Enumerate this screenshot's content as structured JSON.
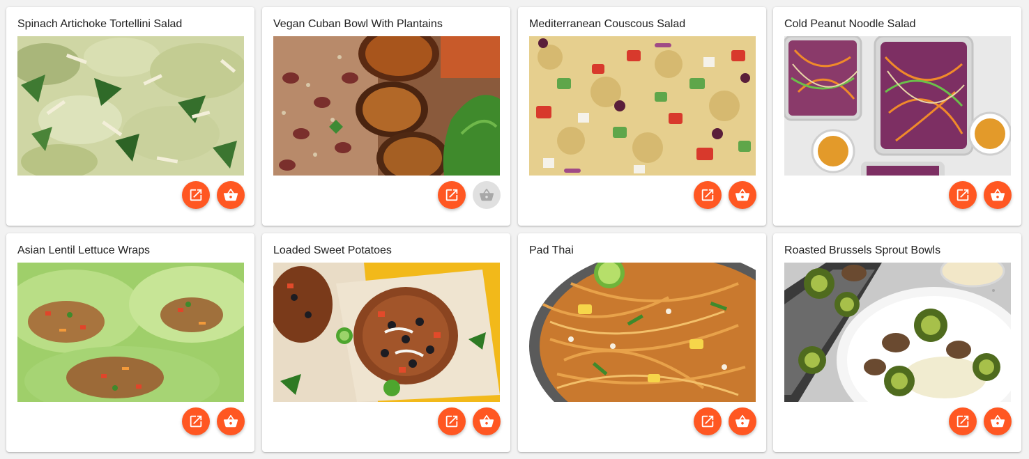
{
  "theme": {
    "accent": "#ff5722",
    "disabled": "#e0e0e0",
    "disabled_icon": "#a8a8a8"
  },
  "recipes": [
    {
      "title": "Spinach Artichoke Tortellini Salad",
      "image": "tortellini-salad-photo",
      "open_icon": "open-in-new-icon",
      "cart_icon": "shopping-basket-icon",
      "cart_enabled": true
    },
    {
      "title": "Vegan Cuban Bowl With Plantains",
      "image": "cuban-bowl-photo",
      "open_icon": "open-in-new-icon",
      "cart_icon": "shopping-basket-icon",
      "cart_enabled": false
    },
    {
      "title": "Mediterranean Couscous Salad",
      "image": "couscous-salad-photo",
      "open_icon": "open-in-new-icon",
      "cart_icon": "shopping-basket-icon",
      "cart_enabled": true
    },
    {
      "title": "Cold Peanut Noodle Salad",
      "image": "peanut-noodle-photo",
      "open_icon": "open-in-new-icon",
      "cart_icon": "shopping-basket-icon",
      "cart_enabled": true
    },
    {
      "title": "Asian Lentil Lettuce Wraps",
      "image": "lettuce-wraps-photo",
      "open_icon": "open-in-new-icon",
      "cart_icon": "shopping-basket-icon",
      "cart_enabled": true
    },
    {
      "title": "Loaded Sweet Potatoes",
      "image": "sweet-potatoes-photo",
      "open_icon": "open-in-new-icon",
      "cart_icon": "shopping-basket-icon",
      "cart_enabled": true
    },
    {
      "title": "Pad Thai",
      "image": "pad-thai-photo",
      "open_icon": "open-in-new-icon",
      "cart_icon": "shopping-basket-icon",
      "cart_enabled": true
    },
    {
      "title": "Roasted Brussels Sprout Bowls",
      "image": "brussels-sprout-photo",
      "open_icon": "open-in-new-icon",
      "cart_icon": "shopping-basket-icon",
      "cart_enabled": true
    }
  ]
}
